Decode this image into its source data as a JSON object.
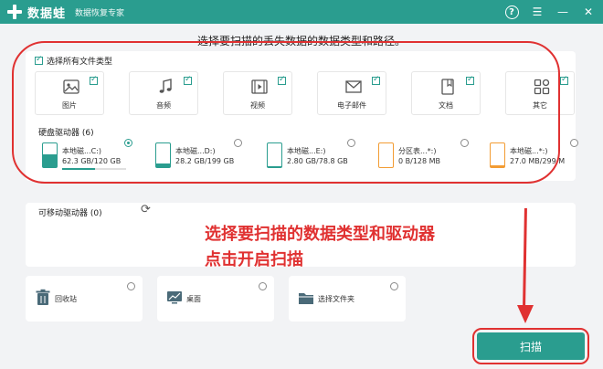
{
  "titlebar": {
    "app_name": "数据蛙",
    "subtitle": "数据恢复专家"
  },
  "heading": "选择要扫描的丢失数据的数据类型和路径。",
  "file_types": {
    "select_all_label": "选择所有文件类型",
    "items": [
      {
        "label": "图片",
        "icon": "image-icon"
      },
      {
        "label": "音频",
        "icon": "music-icon"
      },
      {
        "label": "视频",
        "icon": "video-icon"
      },
      {
        "label": "电子邮件",
        "icon": "mail-icon"
      },
      {
        "label": "文档",
        "icon": "document-icon"
      },
      {
        "label": "其它",
        "icon": "others-icon"
      }
    ]
  },
  "hdd": {
    "title": "硬盘驱动器 (6)",
    "drives": [
      {
        "name": "本地磁...C:)",
        "size": "62.3 GB/120 GB",
        "fill": 0.52,
        "selected": true
      },
      {
        "name": "本地磁...D:)",
        "size": "28.2 GB/199 GB",
        "fill": 0.14,
        "selected": false
      },
      {
        "name": "本地磁...E:)",
        "size": "2.80 GB/78.8 GB",
        "fill": 0.04,
        "selected": false
      },
      {
        "name": "分区表...*:)",
        "size": "0 B/128 MB",
        "fill": 0.0,
        "selected": false
      },
      {
        "name": "本地磁...*:)",
        "size": "27.0 MB/299 M",
        "fill": 0.09,
        "selected": false
      }
    ]
  },
  "removable": {
    "title": "可移动驱动器 (0)"
  },
  "quick_locations": [
    {
      "label": "回收站",
      "icon": "trash-icon"
    },
    {
      "label": "桌面",
      "icon": "desktop-icon"
    },
    {
      "label": "选择文件夹",
      "icon": "folder-icon"
    }
  ],
  "annotation": {
    "line1": "选择要扫描的数据类型和驱动器",
    "line2": "点击开启扫描"
  },
  "scan_button": "扫描",
  "colors": {
    "accent": "#2a9d8f",
    "annotation": "#e03131",
    "drive_orange": "#f39c33"
  }
}
